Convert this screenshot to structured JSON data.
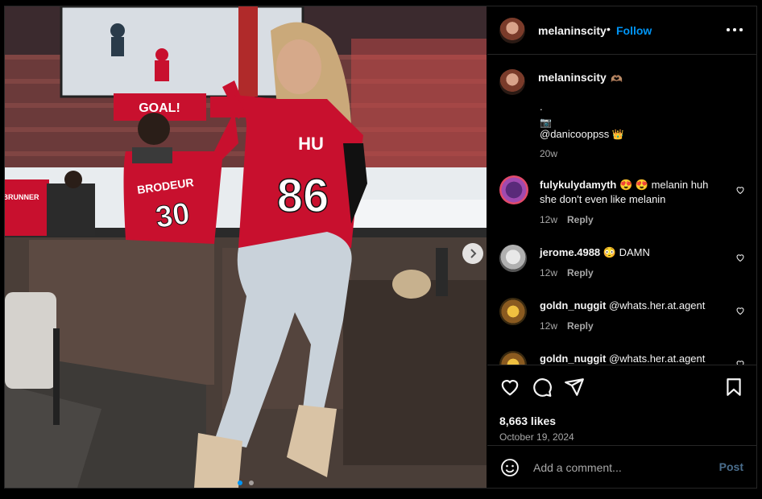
{
  "post": {
    "username": "melaninscity",
    "follow_label": "Follow",
    "dot": "•",
    "caption_emoji": "🫶🏽",
    "caption_line1": ".",
    "caption_camera": "📷",
    "caption_mention": "@danicooppss",
    "caption_crown": "👑",
    "caption_time": "20w",
    "likes": "8,663 likes",
    "date": "October 19, 2024",
    "add_comment_placeholder": "Add a comment...",
    "post_label": "Post"
  },
  "photo": {
    "scoreboard_text": "GOAL!",
    "jersey_left_name": "BRODEUR",
    "jersey_left_number": "30",
    "jersey_center_name": "HU",
    "jersey_center_number": "86",
    "jersey_far_left": "BRUNNER",
    "banner_text": "GOAL"
  },
  "comments": [
    {
      "username": "fulykulydamyth",
      "text_before": "😍 😍 melanin huh",
      "text_line2": "she don't even like melanin",
      "time": "12w",
      "reply": "Reply"
    },
    {
      "username": "jerome.4988",
      "text_before": "😳 DAMN",
      "time": "12w",
      "reply": "Reply"
    },
    {
      "username": "goldn_nuggit",
      "text_before": "@whats.her.at.agent",
      "time": "12w",
      "reply": "Reply"
    },
    {
      "username": "goldn_nuggit",
      "text_before": "@whats.her.at.agent",
      "time": "",
      "reply": ""
    }
  ],
  "colors": {
    "accent": "#0095f6",
    "post_disabled": "#4a6d8c",
    "secondary_text": "#a8a8a8",
    "border": "#262626"
  }
}
